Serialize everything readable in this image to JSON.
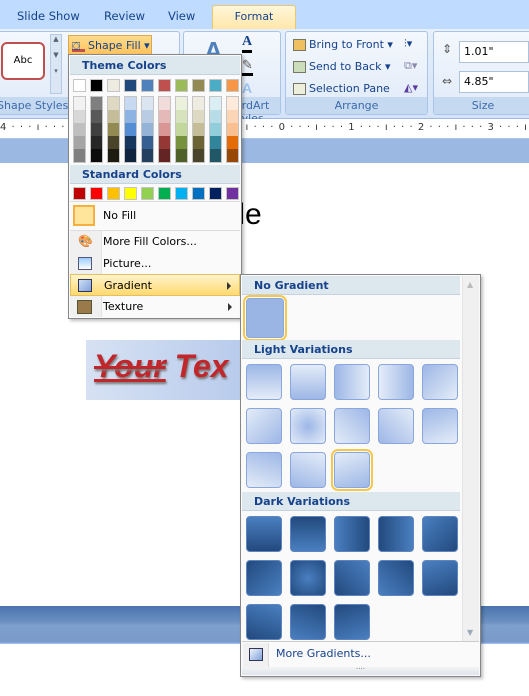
{
  "tabs": [
    {
      "label": "Slide Show"
    },
    {
      "label": "Review"
    },
    {
      "label": "View"
    },
    {
      "label": "Format",
      "active": true
    }
  ],
  "ribbon": {
    "shape_styles": {
      "label": "Shape Styles",
      "preview": "Abc",
      "shape_fill": "Shape Fill"
    },
    "wordart_styles": {
      "label": "WordArt Styles"
    },
    "arrange": {
      "label": "Arrange",
      "bring_to_front": "Bring to Front",
      "send_to_back": "Send to Back",
      "selection_pane": "Selection Pane"
    },
    "size": {
      "label": "Size",
      "height": "1.01\"",
      "width": "4.85\""
    }
  },
  "ruler": "4 · · · ı · · · 3 · · · ı · · · 2 · · · ı · · · 1 · · · ı · · · 0 · · · ı · · · 1 · · · ı · · · 2 · · · ı · · · 3 · · · ı · · · 4 · · · ı ·",
  "slide": {
    "title_fragment": "tle",
    "wordart_word1": "Your",
    "wordart_word2": "Tex"
  },
  "shape_fill_menu": {
    "theme_header": "Theme Colors",
    "theme_colors": [
      "#ffffff",
      "#000000",
      "#eeece1",
      "#1f497d",
      "#4f81bd",
      "#c0504d",
      "#9bbb59",
      "#938953",
      "#4bacc6",
      "#f79646"
    ],
    "theme_shades": [
      [
        "#f2f2f2",
        "#d8d8d8",
        "#bfbfbf",
        "#a5a5a5",
        "#7f7f7f"
      ],
      [
        "#7f7f7f",
        "#595959",
        "#3f3f3f",
        "#262626",
        "#0c0c0c"
      ],
      [
        "#ddd9c3",
        "#c4bd97",
        "#938953",
        "#494429",
        "#1d1b10"
      ],
      [
        "#c6d9f0",
        "#8db3e2",
        "#548dd4",
        "#17365d",
        "#0f243e"
      ],
      [
        "#dbe5f1",
        "#b8cce4",
        "#95b3d7",
        "#366092",
        "#244061"
      ],
      [
        "#f2dcdb",
        "#e5b9b7",
        "#d99694",
        "#953734",
        "#632423"
      ],
      [
        "#ebf1dd",
        "#d7e3bc",
        "#c3d69b",
        "#76923c",
        "#4f6128"
      ],
      [
        "#eeece1",
        "#ddd9c3",
        "#c4bd97",
        "#6b6333",
        "#4a452a"
      ],
      [
        "#dbeef3",
        "#b7dde8",
        "#92cddc",
        "#31859b",
        "#205867"
      ],
      [
        "#fdeada",
        "#fbd5b5",
        "#fac08f",
        "#e36c09",
        "#974806"
      ]
    ],
    "standard_header": "Standard Colors",
    "standard_colors": [
      "#c00000",
      "#ff0000",
      "#ffc000",
      "#ffff00",
      "#92d050",
      "#00b050",
      "#00b0f0",
      "#0070c0",
      "#002060",
      "#7030a0"
    ],
    "no_fill": "No Fill",
    "more_fill_colors": "More Fill Colors...",
    "picture": "Picture...",
    "gradient": "Gradient",
    "texture": "Texture"
  },
  "gradient_menu": {
    "no_gradient": "No Gradient",
    "light_variations": "Light Variations",
    "dark_variations": "Dark Variations",
    "more_gradients": "More Gradients...",
    "selected_light_index": 12
  },
  "colors": {
    "accent_hover": "#ffe38a",
    "menu_header": "#dde7ee",
    "text": "#15428b"
  }
}
